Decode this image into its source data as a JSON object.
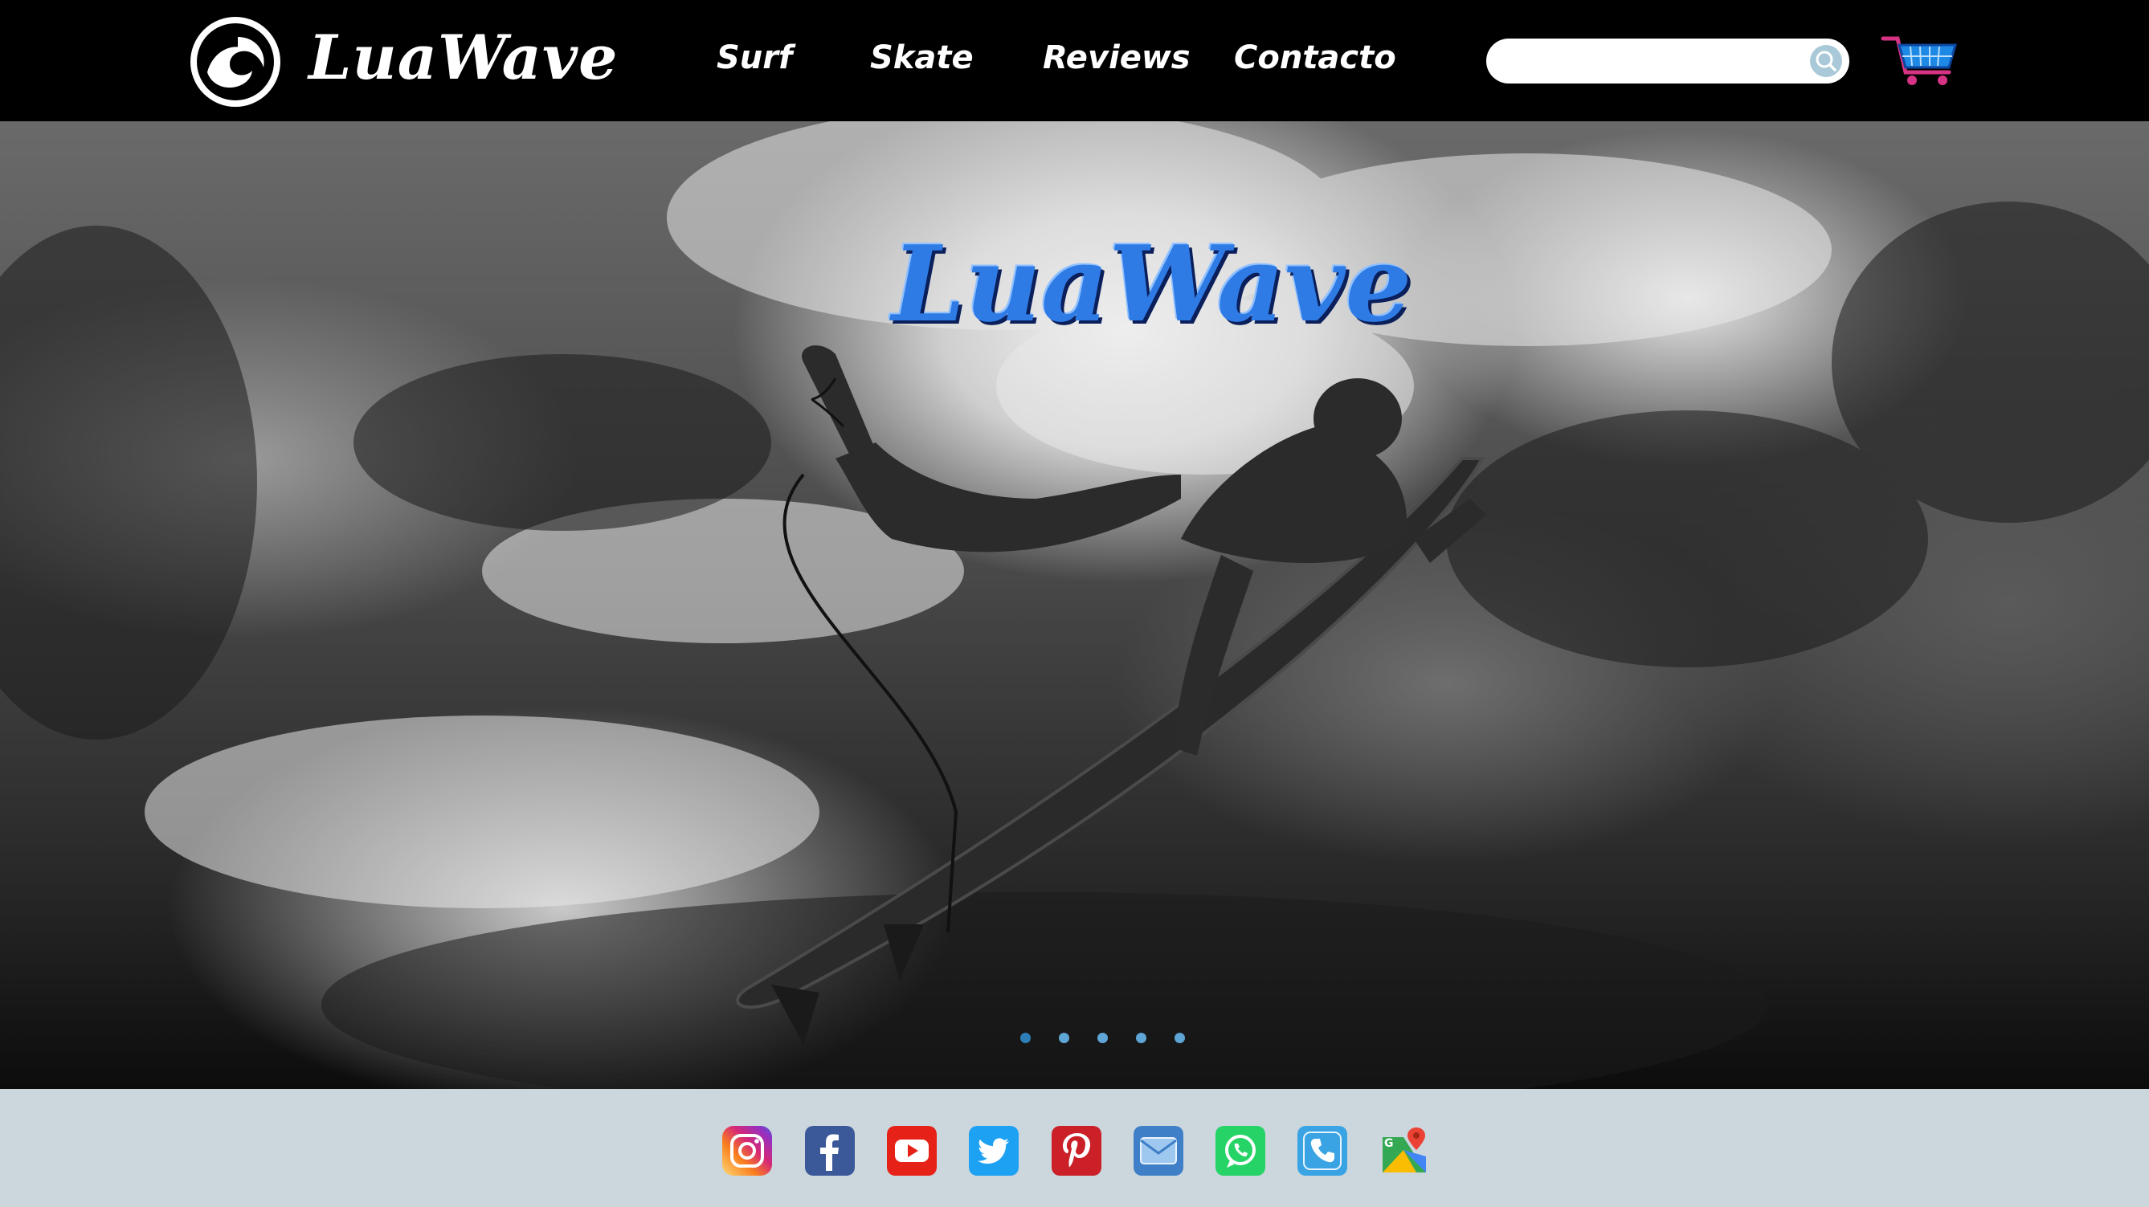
{
  "header": {
    "brand": "LuaWave",
    "nav": [
      {
        "label": "Surf"
      },
      {
        "label": "Skate"
      },
      {
        "label": "Reviews"
      },
      {
        "label": "Contacto"
      }
    ],
    "search": {
      "value": "",
      "placeholder": ""
    },
    "icons": {
      "logo": "wave-logo-icon",
      "search": "search-icon",
      "cart": "cart-icon"
    }
  },
  "hero": {
    "title": "LuaWave",
    "slides_total": 5,
    "active_slide": 1,
    "title_color": "#2f7be6"
  },
  "footer": {
    "social": [
      {
        "name": "instagram-icon"
      },
      {
        "name": "facebook-icon"
      },
      {
        "name": "youtube-icon"
      },
      {
        "name": "twitter-icon"
      },
      {
        "name": "pinterest-icon"
      },
      {
        "name": "email-icon"
      },
      {
        "name": "whatsapp-icon"
      },
      {
        "name": "phone-icon"
      },
      {
        "name": "google-maps-icon"
      }
    ],
    "background": "#cbd6dd"
  }
}
